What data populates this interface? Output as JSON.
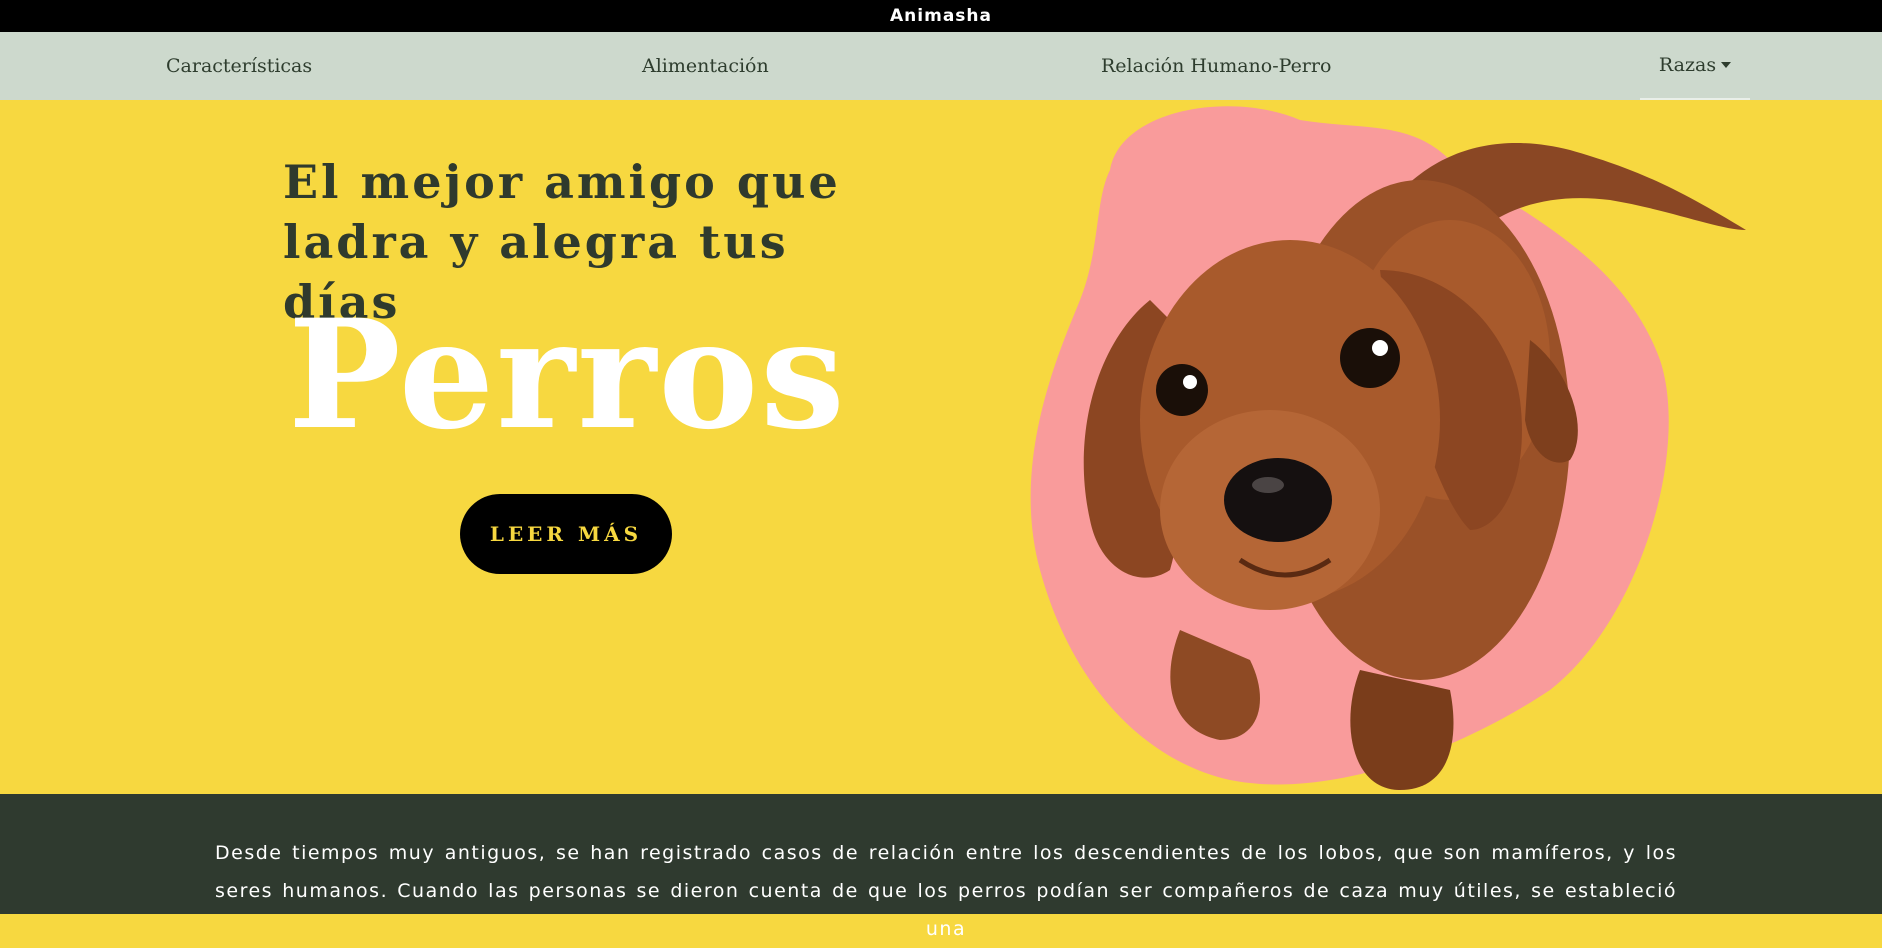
{
  "brand": {
    "name": "Animasha"
  },
  "nav": {
    "items": [
      {
        "label": "Características"
      },
      {
        "label": "Alimentación"
      },
      {
        "label": "Relación Humano-Perro"
      },
      {
        "label": "Razas"
      }
    ]
  },
  "hero": {
    "tagline": "El mejor amigo que ladra y alegra tus días",
    "title": "Perros",
    "cta_label": "LEER MÁS"
  },
  "intro": {
    "text": "Desde tiempos muy antiguos, se han registrado casos de relación entre los descendientes de los lobos, que son mamíferos, y los seres humanos. Cuando las personas se dieron cuenta de que los perros podían ser compañeros de caza muy útiles, se estableció una"
  },
  "colors": {
    "topbar": "#000000",
    "nav_bg": "#cdd9cd",
    "hero_bg": "#f7d840",
    "blob": "#f99b9b",
    "dark_green": "#2f3a2f",
    "button": "#000000",
    "button_text": "#f7d840"
  }
}
